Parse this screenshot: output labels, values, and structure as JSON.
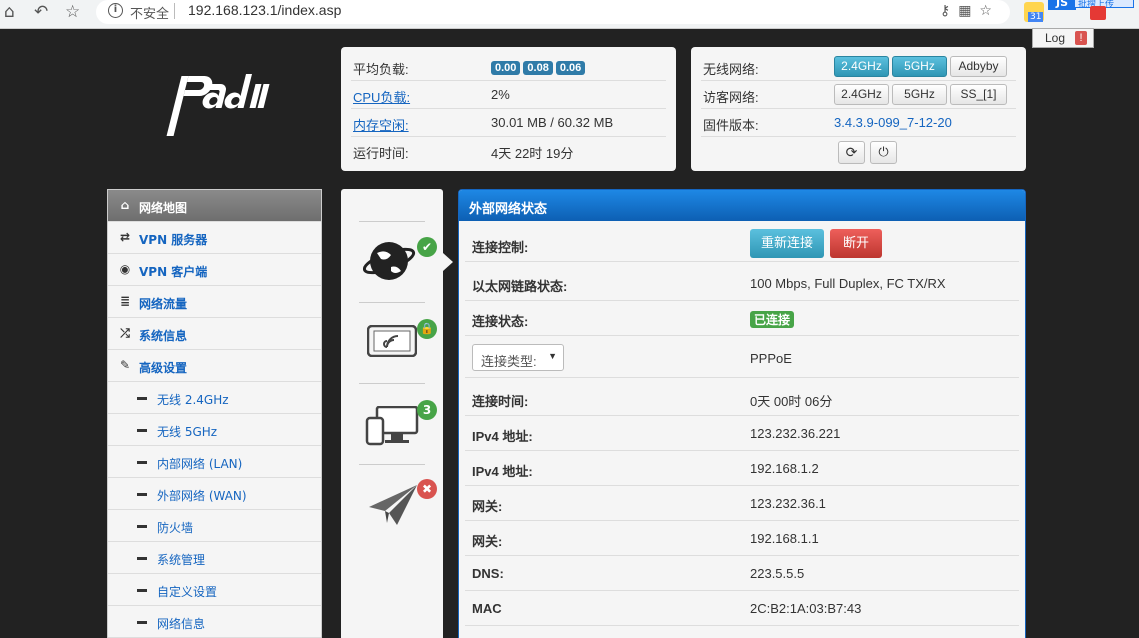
{
  "browser": {
    "insecure_label": "不安全",
    "url": "192.168.123.1/index.asp",
    "ext_badge": "31",
    "ext_tip": "批搜上传",
    "log_label": "Log",
    "log_alert": "!"
  },
  "logo": {
    "text": "padavan"
  },
  "stats": {
    "rows": [
      {
        "label": "平均负载:",
        "loads": [
          "0.00",
          "0.08",
          "0.06"
        ]
      },
      {
        "label": "CPU负载:",
        "value": "2%"
      },
      {
        "label": "内存空闲:",
        "value": "30.01 MB / 60.32 MB"
      },
      {
        "label": "运行时间:",
        "value": "4天 22时 19分"
      }
    ]
  },
  "wifi": {
    "wireless_label": "无线网络:",
    "guest_label": "访客网络:",
    "firmware_label": "固件版本:",
    "firmware_value": "3.4.3.9-099_7-12-20",
    "wireless_buttons": [
      "2.4GHz",
      "5GHz",
      "Adbyby"
    ],
    "guest_buttons": [
      "2.4GHz",
      "5GHz",
      "SS_[1]"
    ]
  },
  "sidebar": {
    "items": [
      {
        "label": "网络地图",
        "icon": "home-icon"
      },
      {
        "label": "VPN 服务器",
        "icon": "retweet-icon"
      },
      {
        "label": "VPN 客户端",
        "icon": "globe-icon"
      },
      {
        "label": "网络流量",
        "icon": "list-icon"
      },
      {
        "label": "系统信息",
        "icon": "random-icon"
      },
      {
        "label": "高级设置",
        "icon": "wrench-icon"
      }
    ],
    "sub_items": [
      "无线 2.4GHz",
      "无线 5GHz",
      "内部网络 (LAN)",
      "外部网络 (WAN)",
      "防火墙",
      "系统管理",
      "自定义设置",
      "网络信息"
    ]
  },
  "icon_col": {
    "badges": [
      "✔",
      "🔒",
      "3",
      "✖"
    ],
    "colors": {
      "green": "#47a447",
      "red": "#d9534f"
    }
  },
  "main": {
    "title": "外部网络状态",
    "control_label": "连接控制:",
    "reconnect_label": "重新连接",
    "disconnect_label": "断开",
    "ethernet_label": "以太网链路状态:",
    "ethernet_value": "100 Mbps, Full Duplex, FC TX/RX",
    "status_label": "连接状态:",
    "status_value": "已连接",
    "type_select": "连接类型:",
    "type_value": "PPPoE",
    "time_label": "连接时间:",
    "time_value": "0天 00时 06分",
    "ipv4_label_1": "IPv4 地址:",
    "ipv4_value_1": "123.232.36.221",
    "ipv4_label_2": "IPv4 地址:",
    "ipv4_value_2": "192.168.1.2",
    "gw_label_1": "网关:",
    "gw_value_1": "123.232.36.1",
    "gw_label_2": "网关:",
    "gw_value_2": "192.168.1.1",
    "dns_label": "DNS:",
    "dns_value": "223.5.5.5",
    "mac_label": "MAC",
    "mac_value": "2C:B2:1A:03:B7:43"
  }
}
